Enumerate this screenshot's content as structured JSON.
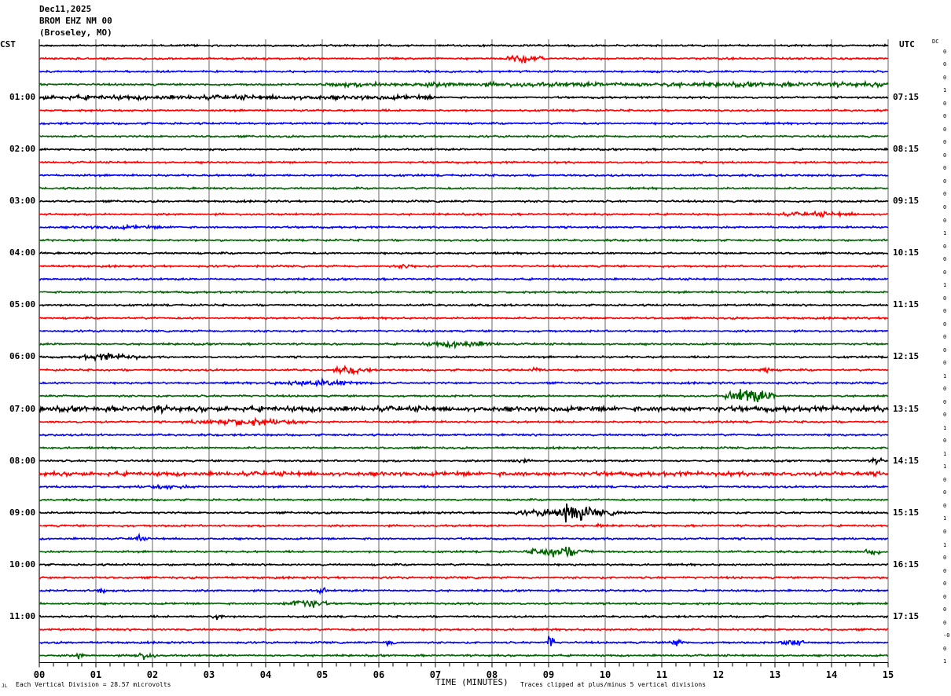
{
  "header": {
    "date": "Dec11,2025",
    "station": "BROM EHZ NM 00",
    "location": "(Broseley, MO)"
  },
  "left_axis": {
    "title": "CST",
    "labels": [
      "01:00",
      "02:00",
      "03:00",
      "04:00",
      "05:00",
      "06:00",
      "07:00",
      "08:00",
      "09:00",
      "10:00",
      "11:00"
    ]
  },
  "right_axis": {
    "title": "UTC",
    "labels": [
      "07:15",
      "08:15",
      "09:15",
      "10:15",
      "11:15",
      "12:15",
      "13:15",
      "14:15",
      "15:15",
      "16:15",
      "17:15"
    ]
  },
  "dc": {
    "title": "DC",
    "values": [
      "0",
      "0",
      "0",
      "1",
      "0",
      "0",
      "0",
      "0",
      "0",
      "0",
      "0",
      "0",
      "0",
      "0",
      "1",
      "0",
      "0",
      "0",
      "1",
      "0",
      "0",
      "0",
      "0",
      "0",
      "0",
      "1",
      "0",
      "0",
      "0",
      "1",
      "0",
      "1",
      "1",
      "0",
      "0",
      "0",
      "1",
      "0",
      "1",
      "0",
      "0",
      "0",
      "0",
      "0",
      "0",
      "-0",
      "0",
      "1"
    ]
  },
  "footer": {
    "scale_text": "Each Vertical Division =   28.57 microvolts",
    "xlabel": "TIME (MINUTES)",
    "clip_text": "Traces clipped at plus/minus 5 vertical divisions",
    "corner_mark": "JL"
  },
  "chart_data": {
    "type": "line",
    "title": "",
    "xlabel": "TIME (MINUTES)",
    "xlim": [
      0,
      15
    ],
    "x_ticks": [
      "00",
      "01",
      "02",
      "03",
      "04",
      "05",
      "06",
      "07",
      "08",
      "09",
      "10",
      "11",
      "12",
      "13",
      "14",
      "15"
    ],
    "grid": true,
    "row_count": 48,
    "row_minutes": 15,
    "colors": [
      "#000000",
      "#ff0000",
      "#0000ff",
      "#006400"
    ],
    "grid_color": "#808080",
    "events": [
      {
        "row": 1,
        "start": 8.2,
        "end": 8.9,
        "amp": 5
      },
      {
        "row": 3,
        "start": 5.0,
        "end": 15,
        "amp": 2.2
      },
      {
        "row": 4,
        "start": 0,
        "end": 7,
        "amp": 2.2
      },
      {
        "row": 5,
        "start": 4.7,
        "end": 4.8,
        "amp": 3
      },
      {
        "row": 13,
        "start": 12.5,
        "end": 15,
        "amp": 2.5
      },
      {
        "row": 14,
        "start": 0,
        "end": 3,
        "amp": 2
      },
      {
        "row": 17,
        "start": 6.2,
        "end": 6.8,
        "amp": 2.5
      },
      {
        "row": 23,
        "start": 6.7,
        "end": 8.2,
        "amp": 4
      },
      {
        "row": 24,
        "start": 0.6,
        "end": 1.9,
        "amp": 4
      },
      {
        "row": 25,
        "start": 5.1,
        "end": 5.9,
        "amp": 4
      },
      {
        "row": 25,
        "start": 8.7,
        "end": 8.9,
        "amp": 4
      },
      {
        "row": 25,
        "start": 12.7,
        "end": 13.0,
        "amp": 4
      },
      {
        "row": 26,
        "start": 4.0,
        "end": 6.0,
        "amp": 3.5
      },
      {
        "row": 27,
        "start": 12.1,
        "end": 13.0,
        "amp": 9
      },
      {
        "row": 28,
        "start": 0,
        "end": 15,
        "amp": 2.5
      },
      {
        "row": 28,
        "start": 1.5,
        "end": 2.6,
        "amp": 4
      },
      {
        "row": 29,
        "start": 2.5,
        "end": 4.8,
        "amp": 4
      },
      {
        "row": 32,
        "start": 8.2,
        "end": 8.7,
        "amp": 3
      },
      {
        "row": 32,
        "start": 14.6,
        "end": 15,
        "amp": 3
      },
      {
        "row": 33,
        "start": 0,
        "end": 15,
        "amp": 2
      },
      {
        "row": 34,
        "start": 1.5,
        "end": 3,
        "amp": 2.2
      },
      {
        "row": 36,
        "start": 8.4,
        "end": 10.4,
        "amp": 5
      },
      {
        "row": 36,
        "start": 9.0,
        "end": 9.8,
        "amp": 11
      },
      {
        "row": 37,
        "start": 9.8,
        "end": 10.0,
        "amp": 3
      },
      {
        "row": 38,
        "start": 1.6,
        "end": 1.9,
        "amp": 4
      },
      {
        "row": 39,
        "start": 8.6,
        "end": 9.8,
        "amp": 6
      },
      {
        "row": 39,
        "start": 14.5,
        "end": 15,
        "amp": 3
      },
      {
        "row": 42,
        "start": 1.0,
        "end": 1.2,
        "amp": 4
      },
      {
        "row": 42,
        "start": 4.9,
        "end": 5.1,
        "amp": 4
      },
      {
        "row": 43,
        "start": 4.3,
        "end": 5.1,
        "amp": 6
      },
      {
        "row": 44,
        "start": 3.0,
        "end": 3.3,
        "amp": 4
      },
      {
        "row": 46,
        "start": 6.1,
        "end": 6.3,
        "amp": 5
      },
      {
        "row": 46,
        "start": 8.95,
        "end": 9.1,
        "amp": 9
      },
      {
        "row": 46,
        "start": 11.1,
        "end": 11.4,
        "amp": 5
      },
      {
        "row": 46,
        "start": 13.1,
        "end": 13.5,
        "amp": 6
      },
      {
        "row": 47,
        "start": 0.6,
        "end": 0.8,
        "amp": 4
      },
      {
        "row": 47,
        "start": 1.6,
        "end": 2.1,
        "amp": 4
      }
    ]
  }
}
